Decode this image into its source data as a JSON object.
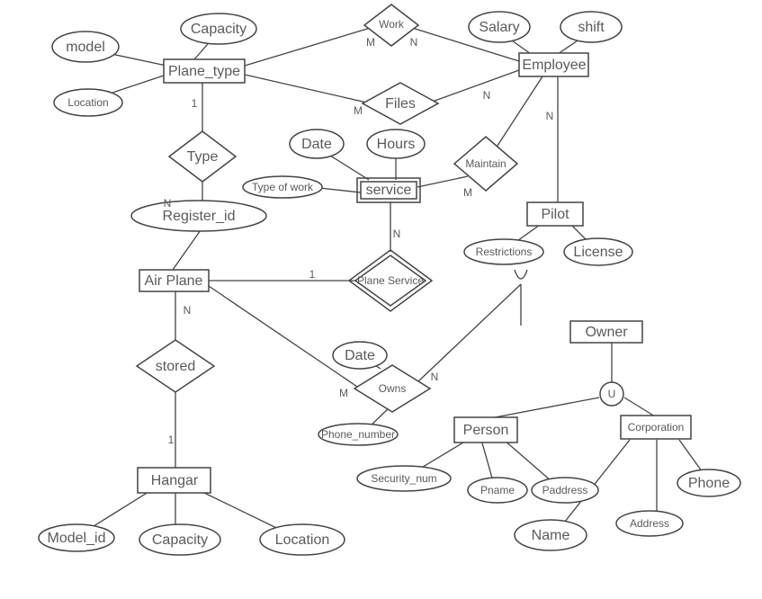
{
  "entities": {
    "plane_type": "Plane_type",
    "employee": "Employee",
    "service": "service",
    "pilot": "Pilot",
    "air_plane": "Air Plane",
    "owner": "Owner",
    "person": "Person",
    "corporation": "Corporation",
    "hangar": "Hangar"
  },
  "relationships": {
    "work": "Work",
    "files": "Files",
    "type": "Type",
    "maintain": "Maintain",
    "plane_service": "Plane Service",
    "owns": "Owns",
    "stored": "stored",
    "union": "U"
  },
  "attributes": {
    "model": "model",
    "capacity_pt": "Capacity",
    "location_pt": "Location",
    "salary": "Salary",
    "shift": "shift",
    "register_id": "Register_id",
    "date_svc": "Date",
    "hours": "Hours",
    "type_of_work": "Type of work",
    "restrictions": "Restrictions",
    "license": "License",
    "date_own": "Date",
    "phone_number": "Phone_number",
    "security_num": "Security_num",
    "pname": "Pname",
    "paddress": "Paddress",
    "name_corp": "Name",
    "address_corp": "Address",
    "phone_corp": "Phone",
    "model_id": "Model_id",
    "capacity_h": "Capacity",
    "location_h": "Location"
  },
  "card": {
    "one": "1",
    "N": "N",
    "M": "M"
  }
}
